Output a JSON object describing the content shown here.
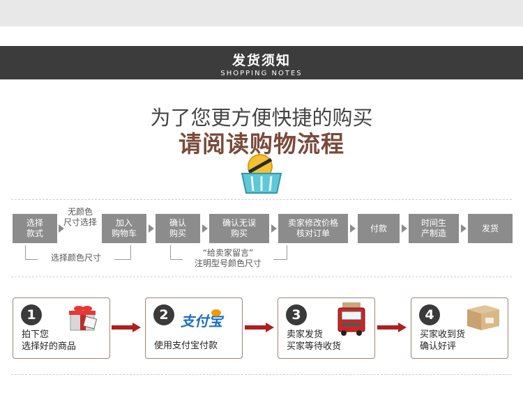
{
  "header": {
    "title": "发货须知",
    "subtitle": "SHOPPING NOTES"
  },
  "hero": {
    "line1": "为了您更方便快捷的购买",
    "line2": "请阅读购物流程",
    "icon": "shopping-basket-icon"
  },
  "flow": {
    "steps": [
      "选择\n款式",
      "加入\n购物车",
      "确认\n购买",
      "确认无误\n购买",
      "卖家修改价格\n核对订单",
      "付款",
      "时间生\n产制造",
      "发货"
    ],
    "note_above": "无颜色\n尺寸选择",
    "note_below_left": "选择颜色尺寸",
    "note_below_mid": "“给卖家留言”\n注明型号颜色尺寸"
  },
  "cards": [
    {
      "number": "1",
      "text": "拍下您\n选择好的商品",
      "icon": "gift-box-icon"
    },
    {
      "number": "2",
      "text": "使用支付宝付款",
      "logo_text": "支付宝",
      "icon": "alipay-logo"
    },
    {
      "number": "3",
      "text": "卖家发货\n买家等待收货",
      "icon": "delivery-truck-icon"
    },
    {
      "number": "4",
      "text": "买家收到货\n确认好评",
      "icon": "parcel-box-icon"
    }
  ],
  "colors": {
    "header_bg": "#3c3c3c",
    "title_accent": "#7a4a3a",
    "step_box": "#8c8c8c",
    "arrow_red": "#b01e1e",
    "card_border": "#9a8478"
  }
}
